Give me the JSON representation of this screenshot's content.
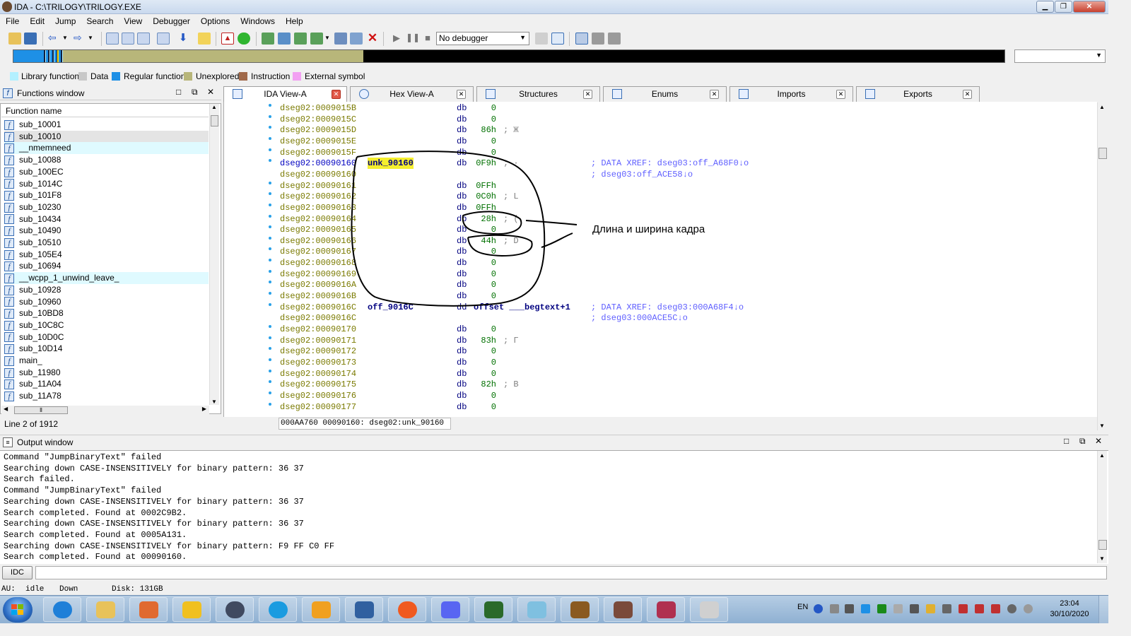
{
  "window": {
    "title": "IDA - C:\\TRILOGY\\TRILOGY.EXE"
  },
  "menu": [
    "File",
    "Edit",
    "Jump",
    "Search",
    "View",
    "Debugger",
    "Options",
    "Windows",
    "Help"
  ],
  "toolbar": {
    "debugger_select": "No debugger"
  },
  "legend": [
    {
      "label": "Library function",
      "color": "#b3f0ff"
    },
    {
      "label": "Data",
      "color": "#c8c8c8"
    },
    {
      "label": "Regular function",
      "color": "#1e90e6"
    },
    {
      "label": "Unexplored",
      "color": "#b8b67a"
    },
    {
      "label": "Instruction",
      "color": "#a0694a"
    },
    {
      "label": "External symbol",
      "color": "#f2a0f2"
    }
  ],
  "functions_window": {
    "title": "Functions window",
    "column": "Function name",
    "items": [
      "sub_10001",
      "sub_10010",
      "__nmemneed",
      "sub_10088",
      "sub_100EC",
      "sub_1014C",
      "sub_101F8",
      "sub_10230",
      "sub_10434",
      "sub_10490",
      "sub_10510",
      "sub_105E4",
      "sub_10694",
      "__wcpp_1_unwind_leave_",
      "sub_10928",
      "sub_10960",
      "sub_10BD8",
      "sub_10C8C",
      "sub_10D0C",
      "sub_10D14",
      "main_",
      "sub_11980",
      "sub_11A04",
      "sub_11A78"
    ],
    "status": "Line 2 of 1912"
  },
  "tabs": [
    {
      "label": "IDA View-A"
    },
    {
      "label": "Hex View-A"
    },
    {
      "label": "Structures"
    },
    {
      "label": "Enums"
    },
    {
      "label": "Imports"
    },
    {
      "label": "Exports"
    }
  ],
  "disasm": [
    {
      "addr": "dseg02:0009015B",
      "label": "",
      "mn": "db",
      "val": "0",
      "cmt": ""
    },
    {
      "addr": "dseg02:0009015C",
      "label": "",
      "mn": "db",
      "val": "0",
      "cmt": ""
    },
    {
      "addr": "dseg02:0009015D",
      "label": "",
      "mn": "db",
      "val": "86h",
      "cmt": "; Ж"
    },
    {
      "addr": "dseg02:0009015E",
      "label": "",
      "mn": "db",
      "val": "0",
      "cmt": ""
    },
    {
      "addr": "dseg02:0009015F",
      "label": "",
      "mn": "db",
      "val": "0",
      "cmt": ""
    },
    {
      "addr": "dseg02:00090160",
      "label": "unk_90160",
      "mn": "db",
      "val": "0F9h",
      "cmt": "; ·",
      "xref": "; DATA XREF: dseg03:off_A68F0↓o"
    },
    {
      "addr": "dseg02:00090160",
      "label": "",
      "mn": "",
      "val": "",
      "cmt": "",
      "xref": "; dseg03:off_ACE58↓o"
    },
    {
      "addr": "dseg02:00090161",
      "label": "",
      "mn": "db",
      "val": "0FFh",
      "cmt": ""
    },
    {
      "addr": "dseg02:00090162",
      "label": "",
      "mn": "db",
      "val": "0C0h",
      "cmt": "; L"
    },
    {
      "addr": "dseg02:00090163",
      "label": "",
      "mn": "db",
      "val": "0FFh",
      "cmt": ""
    },
    {
      "addr": "dseg02:00090164",
      "label": "",
      "mn": "db",
      "val": "28h",
      "cmt": "; ("
    },
    {
      "addr": "dseg02:00090165",
      "label": "",
      "mn": "db",
      "val": "0",
      "cmt": ""
    },
    {
      "addr": "dseg02:00090166",
      "label": "",
      "mn": "db",
      "val": "44h",
      "cmt": "; D"
    },
    {
      "addr": "dseg02:00090167",
      "label": "",
      "mn": "db",
      "val": "0",
      "cmt": ""
    },
    {
      "addr": "dseg02:00090168",
      "label": "",
      "mn": "db",
      "val": "0",
      "cmt": ""
    },
    {
      "addr": "dseg02:00090169",
      "label": "",
      "mn": "db",
      "val": "0",
      "cmt": ""
    },
    {
      "addr": "dseg02:0009016A",
      "label": "",
      "mn": "db",
      "val": "0",
      "cmt": ""
    },
    {
      "addr": "dseg02:0009016B",
      "label": "",
      "mn": "db",
      "val": "0",
      "cmt": ""
    },
    {
      "addr": "dseg02:0009016C",
      "label": "off_9016C",
      "mn": "dd",
      "val": "offset ___begtext+1",
      "cmt": "",
      "xref": "; DATA XREF: dseg03:000A68F4↓o"
    },
    {
      "addr": "dseg02:0009016C",
      "label": "",
      "mn": "",
      "val": "",
      "cmt": "",
      "xref": "; dseg03:000ACE5C↓o"
    },
    {
      "addr": "dseg02:00090170",
      "label": "",
      "mn": "db",
      "val": "0",
      "cmt": ""
    },
    {
      "addr": "dseg02:00090171",
      "label": "",
      "mn": "db",
      "val": "83h",
      "cmt": "; Г"
    },
    {
      "addr": "dseg02:00090172",
      "label": "",
      "mn": "db",
      "val": "0",
      "cmt": ""
    },
    {
      "addr": "dseg02:00090173",
      "label": "",
      "mn": "db",
      "val": "0",
      "cmt": ""
    },
    {
      "addr": "dseg02:00090174",
      "label": "",
      "mn": "db",
      "val": "0",
      "cmt": ""
    },
    {
      "addr": "dseg02:00090175",
      "label": "",
      "mn": "db",
      "val": "82h",
      "cmt": "; В"
    },
    {
      "addr": "dseg02:00090176",
      "label": "",
      "mn": "db",
      "val": "0",
      "cmt": ""
    },
    {
      "addr": "dseg02:00090177",
      "label": "",
      "mn": "db",
      "val": "0",
      "cmt": ""
    }
  ],
  "annotation": "Длина и ширина кадра",
  "disasm_status": "000AA760 00090160: dseg02:unk_90160",
  "output_window": {
    "title": "Output window",
    "lines": [
      "Command \"JumpBinaryText\" failed",
      "Searching down CASE-INSENSITIVELY for binary pattern: 36 37",
      "Search failed.",
      "Command \"JumpBinaryText\" failed",
      "Searching down CASE-INSENSITIVELY for binary pattern: 36 37",
      "Search completed. Found at 0002C9B2.",
      "Searching down CASE-INSENSITIVELY for binary pattern: 36 37",
      "Search completed. Found at 0005A131.",
      "Searching down CASE-INSENSITIVELY for binary pattern: F9 FF C0 FF",
      "Search completed. Found at 00090160."
    ]
  },
  "idc_button": "IDC",
  "statusbar": {
    "au": "AU:",
    "state": "idle",
    "dir": "Down",
    "disk": "Disk: 131GB"
  },
  "taskbar": {
    "apps": [
      "internet-explorer",
      "explorer",
      "paint",
      "winamp",
      "steam",
      "skype",
      "folder-app",
      "debugger-app",
      "firefox",
      "discord",
      "terminal",
      "notepad",
      "dosbox",
      "ida",
      "winrar",
      "calculator"
    ],
    "tray": {
      "lang": "EN",
      "time": "23:04",
      "date": "30/10/2020"
    }
  }
}
